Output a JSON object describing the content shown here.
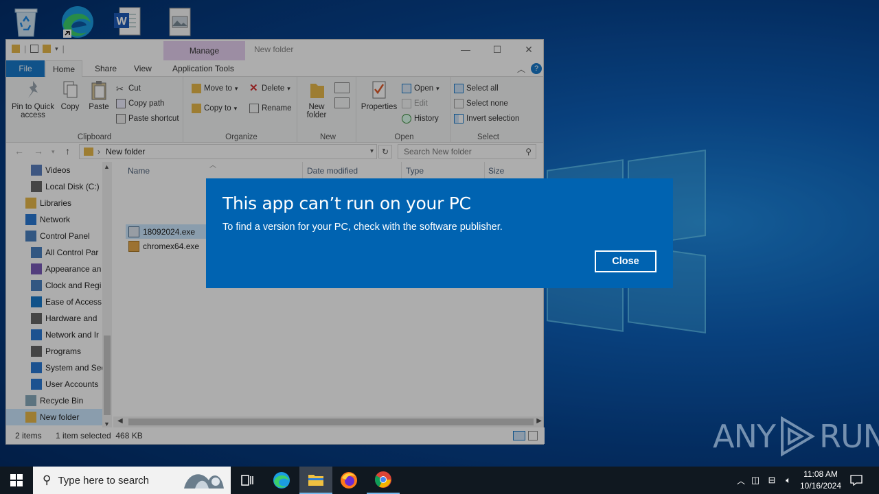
{
  "desktop": {
    "icons": [
      "recycle-bin-icon",
      "edge-icon",
      "word-icon",
      "image-file-icon"
    ]
  },
  "explorer": {
    "title": "New folder",
    "manage_tab": "Manage",
    "tabs": [
      "File",
      "Home",
      "Share",
      "View",
      "Application Tools"
    ],
    "ribbon": {
      "clipboard": {
        "group": "Clipboard",
        "pin": "Pin to Quick access",
        "copy": "Copy",
        "paste": "Paste",
        "cut": "Cut",
        "copy_path": "Copy path",
        "paste_shortcut": "Paste shortcut"
      },
      "organize": {
        "group": "Organize",
        "move_to": "Move to",
        "copy_to": "Copy to",
        "delete": "Delete",
        "rename": "Rename"
      },
      "new": {
        "group": "New",
        "new_folder": "New folder"
      },
      "open": {
        "group": "Open",
        "properties": "Properties",
        "open": "Open",
        "edit": "Edit",
        "history": "History"
      },
      "select": {
        "group": "Select",
        "select_all": "Select all",
        "select_none": "Select none",
        "invert": "Invert selection"
      }
    },
    "address": {
      "path": "New folder",
      "search_placeholder": "Search New folder"
    },
    "nav": [
      "Videos",
      "Local Disk (C:)",
      "Libraries",
      "Network",
      "Control Panel",
      "All Control Par",
      "Appearance an",
      "Clock and Regi",
      "Ease of Access",
      "Hardware and",
      "Network and Ir",
      "Programs",
      "System and Sec",
      "User Accounts",
      "Recycle Bin",
      "New folder"
    ],
    "columns": [
      "Name",
      "Date modified",
      "Type",
      "Size"
    ],
    "files": [
      {
        "name": "18092024.exe",
        "selected": true
      },
      {
        "name": "chromex64.exe",
        "selected": false
      }
    ],
    "status": {
      "count": "2 items",
      "selection": "1 item selected  468 KB"
    }
  },
  "dialog": {
    "title": "This app can’t run on your PC",
    "message": "To find a version for your PC, check with the software publisher.",
    "close": "Close",
    "color": "#0063b1"
  },
  "taskbar": {
    "search_placeholder": "Type here to search",
    "time": "11:08 AM",
    "date": "10/16/2024",
    "apps": [
      "task-view",
      "edge",
      "file-explorer",
      "firefox",
      "chrome"
    ],
    "active": "file-explorer"
  },
  "watermark": {
    "left": "ANY",
    "right": "RUN"
  }
}
